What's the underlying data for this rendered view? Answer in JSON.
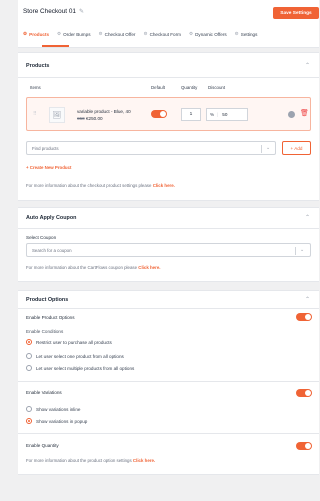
{
  "header": {
    "title": "Store Checkout 01",
    "save_label": "Save Settings",
    "tabs": [
      {
        "label": "Products",
        "icon": "⚙"
      },
      {
        "label": "Order Bumps",
        "icon": "⚙"
      },
      {
        "label": "Checkout Offer",
        "icon": "⚙"
      },
      {
        "label": "Checkout Form",
        "icon": "⚙"
      },
      {
        "label": "Dynamic Offers",
        "icon": "⚙"
      },
      {
        "label": "Settings",
        "icon": "⚙"
      }
    ]
  },
  "products": {
    "title": "Products",
    "columns": {
      "items": "Items",
      "default": "Default",
      "quantity": "Quantity",
      "discount": "Discount"
    },
    "row": {
      "name": "variable product - Blue, 40",
      "old_price": "€60",
      "price": "€250.00",
      "quantity": "1",
      "discount_type": "%",
      "discount_value": "50",
      "default_on": true
    },
    "find_placeholder": "Find products",
    "add_label": "+ Add",
    "create_label": "+ Create New Product",
    "info_text": "For more information about the checkout product settings please",
    "info_link": "Click here."
  },
  "coupon": {
    "title": "Auto Apply Coupon",
    "select_label": "Select Coupon",
    "placeholder": "Search for a coupon",
    "info_text": "For more information about the CartFlows coupon please",
    "info_link": "Click here."
  },
  "options": {
    "title": "Product Options",
    "enable_label": "Enable Product Options",
    "conditions_label": "Enable Conditions",
    "conditions": [
      {
        "label": "Restrict user to purchase all products",
        "checked": true
      },
      {
        "label": "Let user select one product from all options",
        "checked": false
      },
      {
        "label": "Let user select multiple products from all options",
        "checked": false
      }
    ],
    "variations_label": "Enable Variations",
    "variations": [
      {
        "label": "Show variations inline",
        "checked": false
      },
      {
        "label": "Show variations in popup",
        "checked": true
      }
    ],
    "quantity_label": "Enable Quantity",
    "info_text": "For more information about the product option settings",
    "info_link": "Click here."
  },
  "colors": {
    "accent": "#f06335",
    "danger": "#ef4444"
  }
}
